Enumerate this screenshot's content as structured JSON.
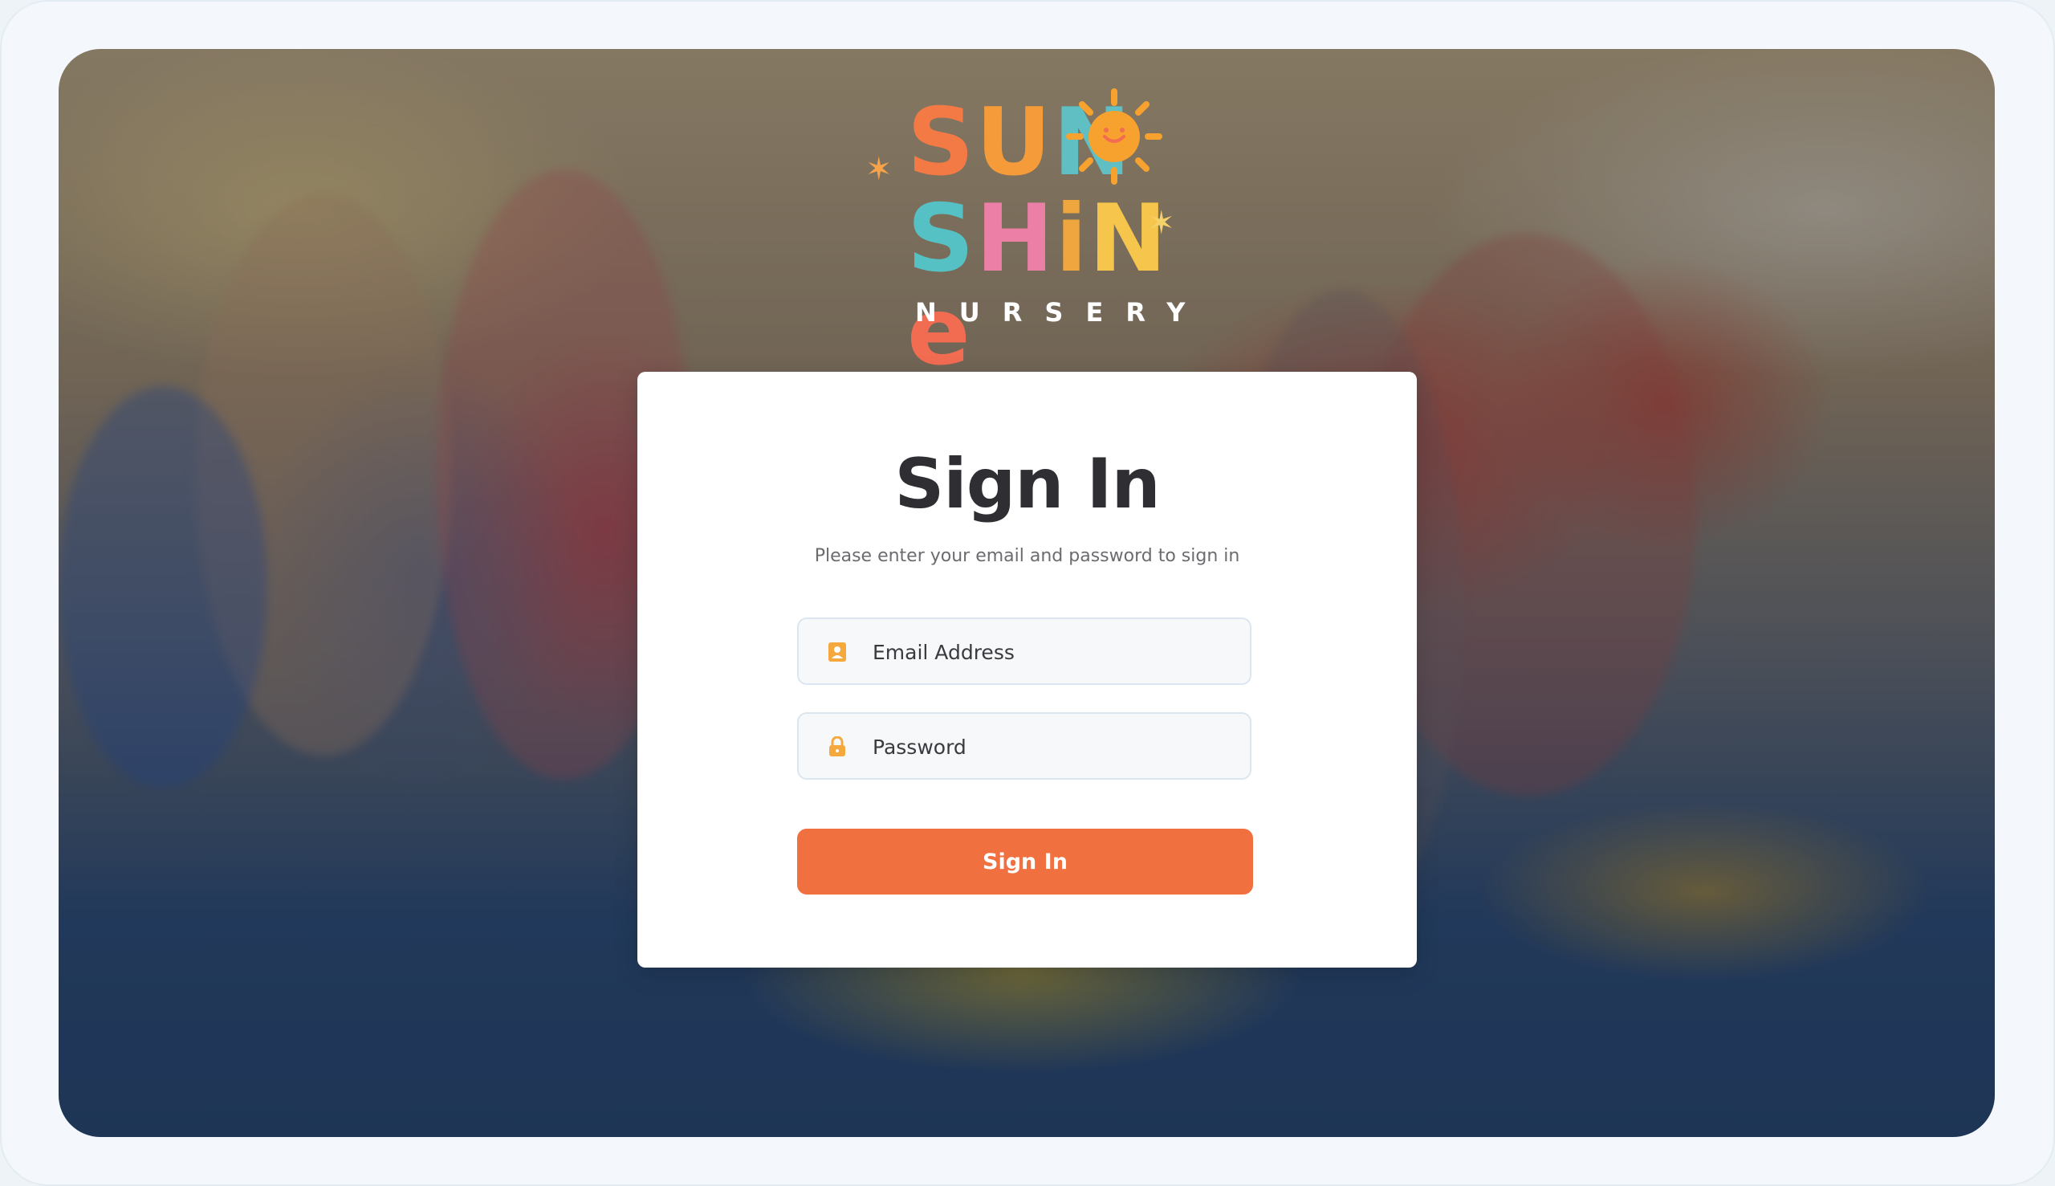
{
  "logo": {
    "line1": [
      "S",
      "U",
      "N"
    ],
    "line2": [
      "S",
      "H",
      "i",
      "N",
      "e"
    ],
    "subtitle": "NURSERY",
    "colors": {
      "S": "#f47a45",
      "U": "#f59b3a",
      "N": "#e9a54a",
      "S2": "#56c1c4",
      "H": "#ec7fa5",
      "i": "#f0a63f",
      "N2": "#f6c54b",
      "e": "#f26c52",
      "sun": "#f7a12e"
    }
  },
  "signin": {
    "title": "Sign In",
    "subtitle": "Please enter your email and password to sign in",
    "email_placeholder": "Email Address",
    "email_icon": "user-badge-icon",
    "password_placeholder": "Password",
    "password_icon": "lock-icon",
    "button_label": "Sign In",
    "accent": "#f1703f",
    "icon_color": "#f5a83c"
  }
}
